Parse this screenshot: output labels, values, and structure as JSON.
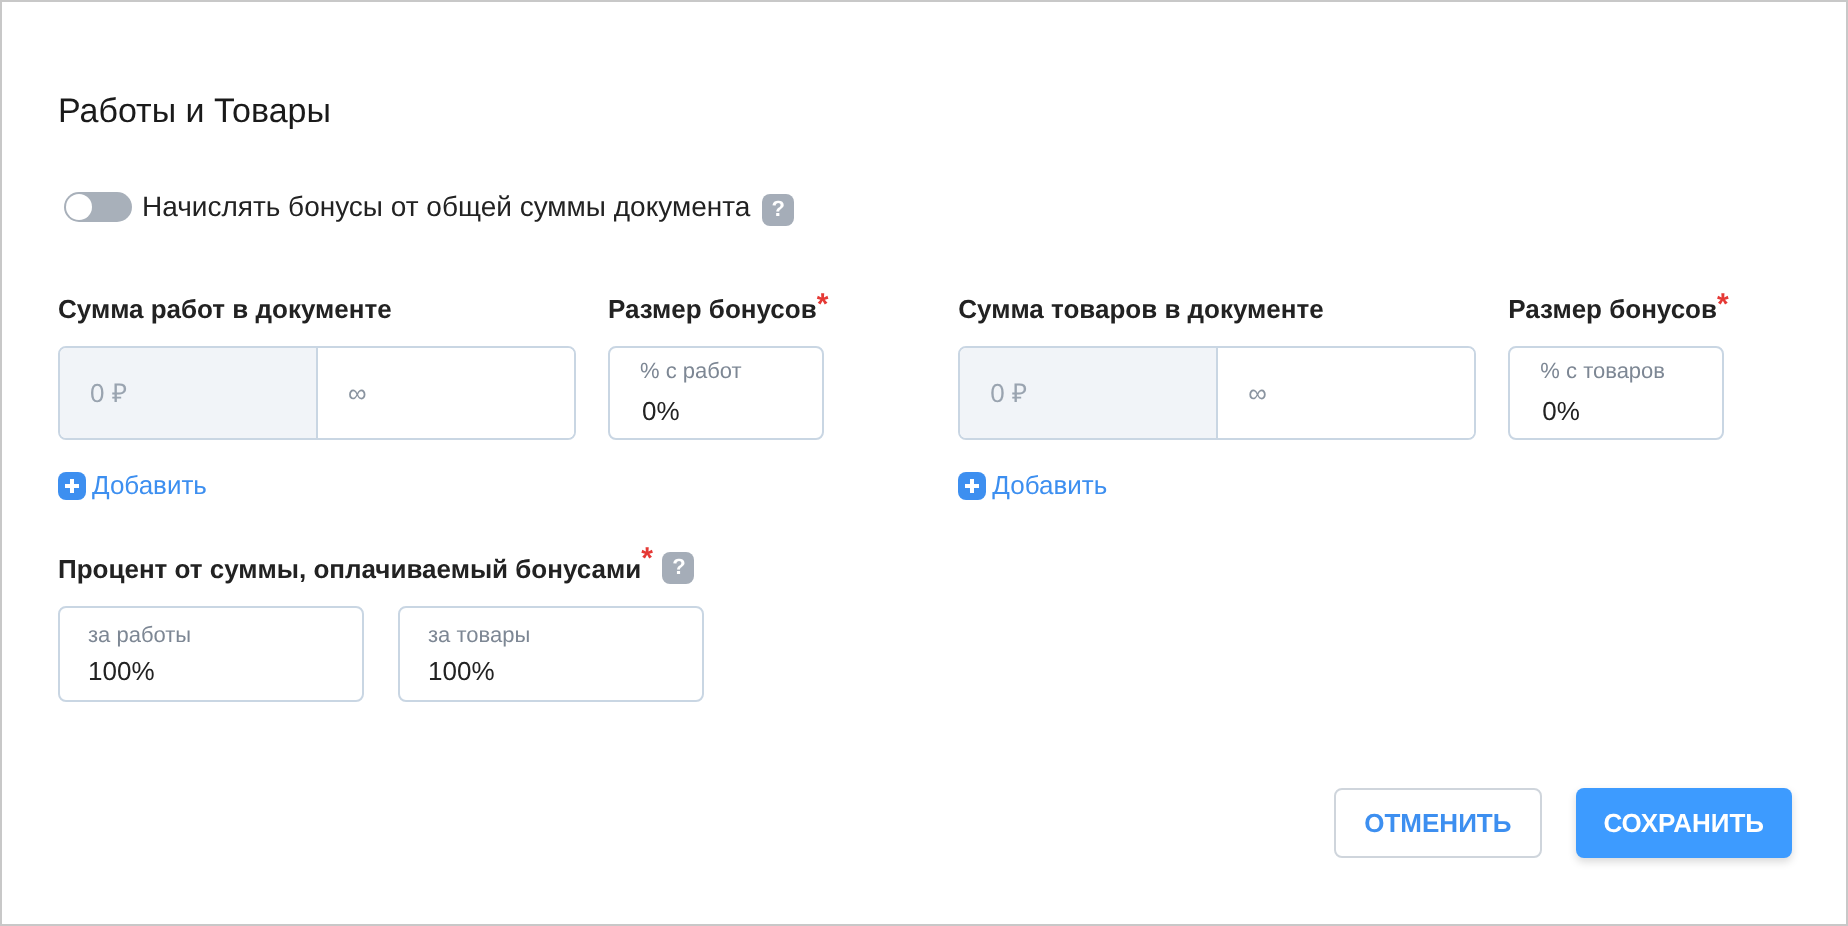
{
  "title": "Работы и Товары",
  "toggle": {
    "label": "Начислять бонусы от общей суммы документа",
    "on": false,
    "help": "?"
  },
  "groups": [
    {
      "range_label": "Сумма работ в документе",
      "from_placeholder": "0 ₽",
      "to_placeholder": "∞",
      "bonus_label": "Размер бонусов",
      "required_mark": "*",
      "bonus_field": {
        "label": "% с работ",
        "value": "0%"
      },
      "add_link": "Добавить"
    },
    {
      "range_label": "Сумма товаров в документе",
      "from_placeholder": "0 ₽",
      "to_placeholder": "∞",
      "bonus_label": "Размер бонусов",
      "required_mark": "*",
      "bonus_field": {
        "label": "% с товаров",
        "value": "0%"
      },
      "add_link": "Добавить"
    }
  ],
  "percent": {
    "label": "Процент от суммы, оплачиваемый бонусами",
    "required_mark": "*",
    "help": "?",
    "fields": [
      {
        "label": "за работы",
        "value": "100%"
      },
      {
        "label": "за товары",
        "value": "100%"
      }
    ]
  },
  "buttons": [
    {
      "label": "ОТМЕНИТЬ",
      "kind": "secondary"
    },
    {
      "label": "СОХРАНИТЬ",
      "kind": "primary"
    }
  ]
}
